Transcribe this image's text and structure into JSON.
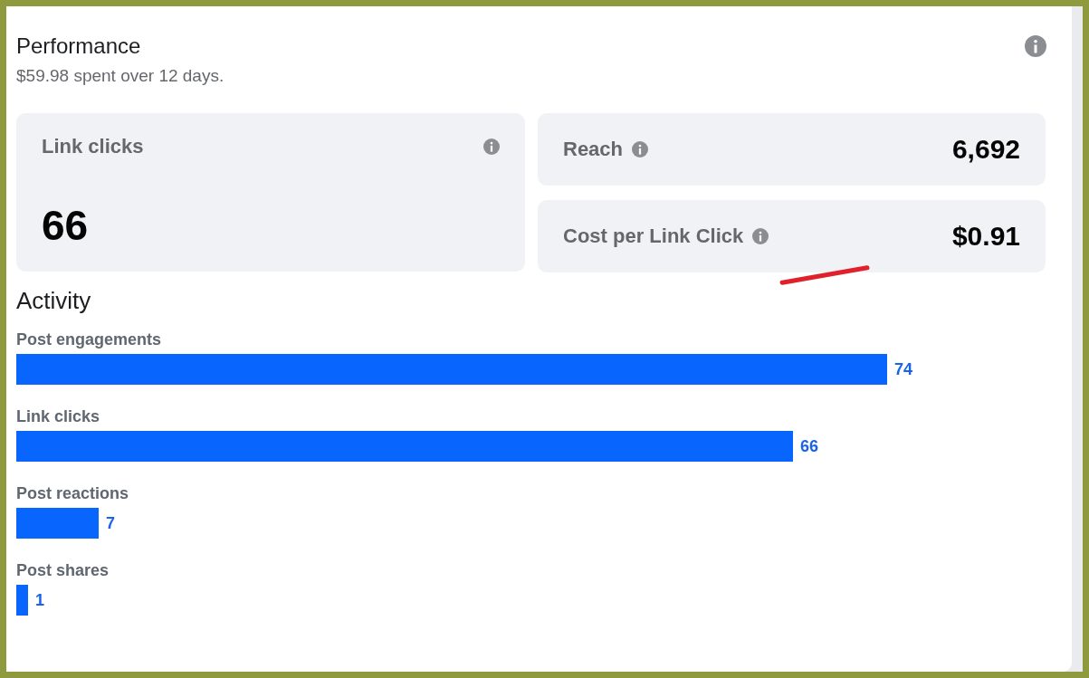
{
  "header": {
    "title": "Performance",
    "subtitle": "$59.98 spent over 12 days."
  },
  "tiles": [
    {
      "kind": "large",
      "label": "Link clicks",
      "value": "66"
    },
    {
      "kind": "row",
      "label": "Reach",
      "value": "6,692"
    },
    {
      "kind": "row",
      "label": "Cost per Link Click",
      "value": "$0.91"
    }
  ],
  "activity": {
    "title": "Activity",
    "chart_data": {
      "type": "bar",
      "orientation": "horizontal",
      "categories": [
        "Post engagements",
        "Link clicks",
        "Post reactions",
        "Post shares"
      ],
      "values": [
        74,
        66,
        7,
        1
      ],
      "data_labels": true
    }
  }
}
